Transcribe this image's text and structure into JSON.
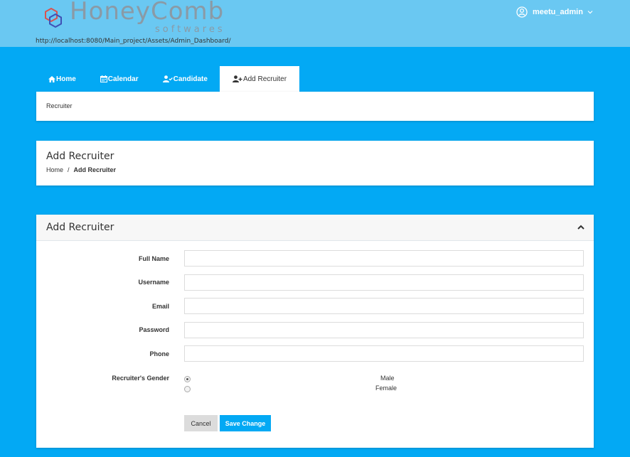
{
  "header": {
    "logo_main": "HoneyComb",
    "logo_sub": "softwares",
    "url": "http://localhost:8080/Main_project/Assets/Admin_Dashboard/",
    "username": "meetu_admin",
    "user_icon": "user-circle-icon",
    "dropdown_icon": "chevron-down-icon"
  },
  "tabs": [
    {
      "label": "Home",
      "icon": "home-icon",
      "active": false
    },
    {
      "label": "Calendar",
      "icon": "calendar-icon",
      "active": false
    },
    {
      "label": "Candidate",
      "icon": "user-check-icon",
      "active": false
    },
    {
      "label": "Add Recruiter",
      "icon": "user-plus-icon",
      "active": true
    }
  ],
  "tab_content": {
    "text": "Recruiter"
  },
  "page": {
    "title": "Add Recruiter",
    "breadcrumb": {
      "home": "Home",
      "separator": "/",
      "current": "Add Recruiter"
    }
  },
  "form": {
    "title": "Add Recruiter",
    "collapse_icon": "chevron-up-icon",
    "fields": [
      {
        "label": "Full Name",
        "value": "",
        "placeholder": ""
      },
      {
        "label": "Username",
        "value": "",
        "placeholder": ""
      },
      {
        "label": "Email",
        "value": "",
        "placeholder": ""
      },
      {
        "label": "Password",
        "value": "",
        "placeholder": ""
      },
      {
        "label": "Phone",
        "value": "",
        "placeholder": ""
      }
    ],
    "gender": {
      "label": "Recruiter's Gender",
      "options": [
        {
          "label": "Male",
          "checked": true
        },
        {
          "label": "Female",
          "checked": false
        }
      ]
    },
    "buttons": {
      "cancel": "Cancel",
      "save": "Save Change"
    }
  },
  "colors": {
    "accent": "#03a9f4",
    "header": "#6ac8f2",
    "logo": "#8a9aa6"
  }
}
